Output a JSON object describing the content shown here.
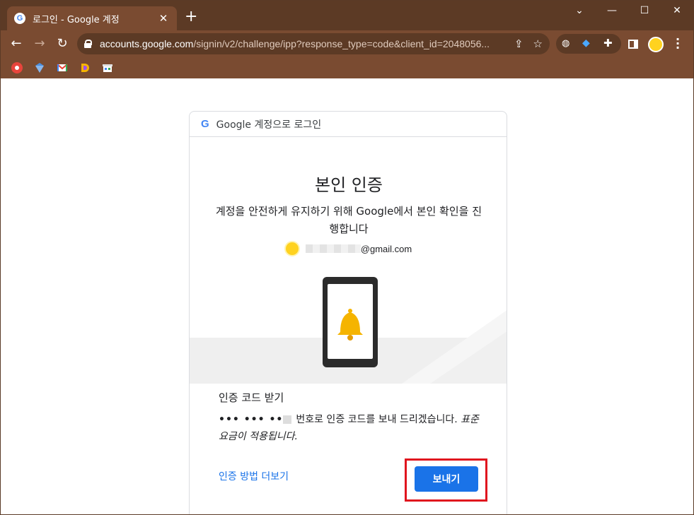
{
  "browser": {
    "tab_title": "로그인 - Google 계정",
    "favicon": "G",
    "new_tab_symbol": "+",
    "window_controls": {
      "chevron": "⌄",
      "minimize": "—",
      "maximize": "☐",
      "close": "✕"
    },
    "url_host": "accounts.google.com",
    "url_path": "/signin/v2/challenge/ipp?response_type=code&client_id=2048056...",
    "bookmarks": [
      "bookmark-1-icon",
      "bookmark-2-icon",
      "gmail-icon",
      "bookmark-d-icon",
      "bookmark-store-icon"
    ],
    "colors": {
      "chrome_dark": "#5c3a25",
      "chrome_light": "#7a4b31"
    }
  },
  "card": {
    "header": "Google 계정으로 로그인",
    "title": "본인 인증",
    "subtitle": "계정을 안전하게 유지하기 위해 Google에서 본인 확인을 진행합니다",
    "account_domain": "@gmail.com",
    "section_title": "인증 코드 받기",
    "phone_masked": "••• ••• ••",
    "body_text": "번호로 인증 코드를 보내 드리겠습니다.",
    "body_italic": "표준 요금이 적용됩니다.",
    "more_link": "인증 방법 더보기",
    "send_button": "보내기",
    "colors": {
      "accent": "#1a73e8",
      "highlight": "#e0141e"
    }
  }
}
